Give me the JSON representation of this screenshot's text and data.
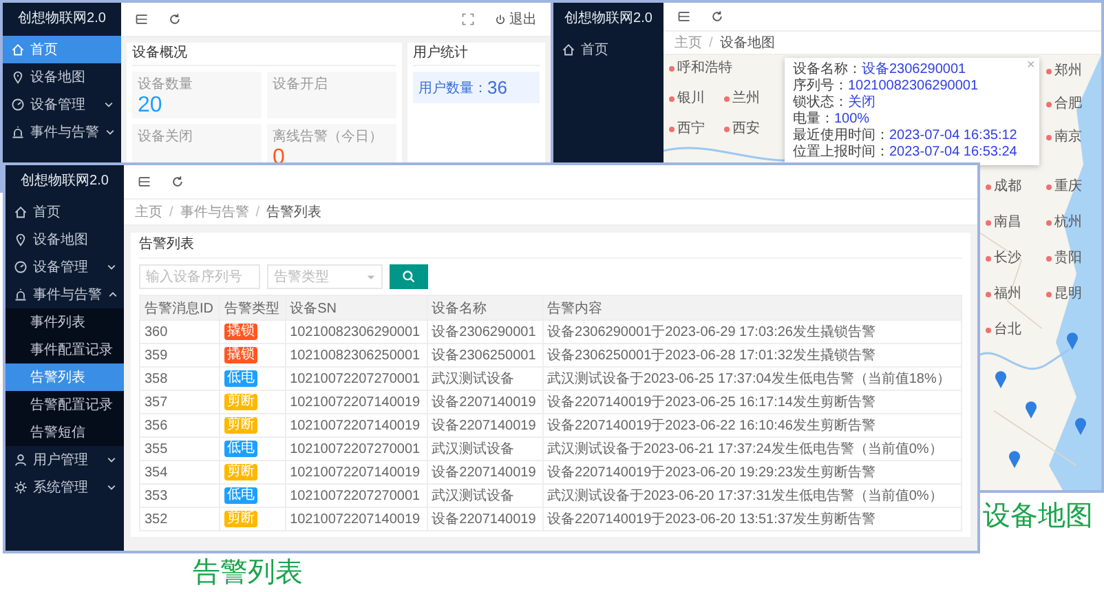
{
  "dashboard_window": {
    "app_title": "创想物联网2.0",
    "menu": [
      {
        "label": "首页",
        "kind": "home",
        "selected": true
      },
      {
        "label": "设备地图",
        "kind": "pin",
        "selected": false
      },
      {
        "label": "设备管理",
        "kind": "gauge",
        "selected": false,
        "expanded": false
      },
      {
        "label": "事件与告警",
        "kind": "alarm",
        "selected": false,
        "expanded": false
      }
    ],
    "logout": "退出",
    "overview": {
      "title": "设备概况",
      "stats": [
        {
          "label": "设备数量",
          "value": "20",
          "color": "#1e9fff"
        },
        {
          "label": "设备开启"
        },
        {
          "label": "设备关闭"
        },
        {
          "label": "离线告警（今日）",
          "value": "0",
          "color": "#ff5722"
        }
      ]
    },
    "users": {
      "title": "用户统计",
      "label": "用户数量：",
      "value": "36"
    }
  },
  "map_window": {
    "app_title": "创想物联网2.0",
    "menu": [
      {
        "label": "首页",
        "kind": "home",
        "selected": false
      }
    ],
    "breadcrumb": {
      "separator": "/",
      "items": [
        "主页",
        "设备地图"
      ]
    },
    "popup": {
      "close": "×",
      "fields": [
        {
          "label": "设备名称：",
          "value": "设备2306290001"
        },
        {
          "label": "序列号：",
          "value": "10210082306290001"
        },
        {
          "label": "锁状态：",
          "value": "关闭"
        },
        {
          "label": "电量：",
          "value": "100%"
        },
        {
          "label": "最近使用时间：",
          "value": "2023-07-04 16:35:12"
        },
        {
          "label": "位置上报时间：",
          "value": "2023-07-04 16:53:24"
        }
      ]
    },
    "cities": [
      "呼和浩特",
      "银川",
      "西宁",
      "兰州",
      "西安",
      "郑州",
      "合肥",
      "南京",
      "成都",
      "重庆",
      "南昌",
      "杭州",
      "长沙",
      "贵阳",
      "福州",
      "昆明",
      "台北"
    ]
  },
  "alarm_window": {
    "app_title": "创想物联网2.0",
    "menu": [
      {
        "label": "首页",
        "kind": "home",
        "selected": false
      },
      {
        "label": "设备地图",
        "kind": "pin",
        "selected": false
      },
      {
        "label": "设备管理",
        "kind": "gauge",
        "selected": false,
        "expanded": false
      },
      {
        "label": "事件与告警",
        "kind": "alarm",
        "selected": false,
        "expanded": true,
        "children": [
          {
            "label": "事件列表",
            "selected": false
          },
          {
            "label": "事件配置记录",
            "selected": false
          },
          {
            "label": "告警列表",
            "selected": true
          },
          {
            "label": "告警配置记录",
            "selected": false
          },
          {
            "label": "告警短信",
            "selected": false
          }
        ]
      },
      {
        "label": "用户管理",
        "kind": "user",
        "selected": false,
        "expanded": false
      },
      {
        "label": "系统管理",
        "kind": "gear",
        "selected": false,
        "expanded": false
      }
    ],
    "breadcrumb": {
      "separator": "/",
      "items": [
        "主页",
        "事件与告警",
        "告警列表"
      ]
    },
    "card_title": "告警列表",
    "filters": {
      "serial_placeholder": "输入设备序列号",
      "type_placeholder": "告警类型"
    },
    "columns": [
      "告警消息ID",
      "告警类型",
      "设备SN",
      "设备名称",
      "告警内容"
    ],
    "rows": [
      {
        "id": "360",
        "type": "撬锁",
        "color": "#ff5722",
        "sn": "10210082306290001",
        "name": "设备2306290001",
        "content": "设备2306290001于2023-06-29 17:03:26发生撬锁告警"
      },
      {
        "id": "359",
        "type": "撬锁",
        "color": "#ff5722",
        "sn": "10210082306250001",
        "name": "设备2306250001",
        "content": "设备2306250001于2023-06-28 17:01:32发生撬锁告警"
      },
      {
        "id": "358",
        "type": "低电",
        "color": "#1e9fff",
        "sn": "10210072207270001",
        "name": "武汉测试设备",
        "content": "武汉测试设备于2023-06-25 17:37:04发生低电告警（当前值18%）"
      },
      {
        "id": "357",
        "type": "剪断",
        "color": "#ffb800",
        "sn": "10210072207140019",
        "name": "设备2207140019",
        "content": "设备2207140019于2023-06-25 16:17:14发生剪断告警"
      },
      {
        "id": "356",
        "type": "剪断",
        "color": "#ffb800",
        "sn": "10210072207140019",
        "name": "设备2207140019",
        "content": "设备2207140019于2023-06-22 16:10:46发生剪断告警"
      },
      {
        "id": "355",
        "type": "低电",
        "color": "#1e9fff",
        "sn": "10210072207270001",
        "name": "武汉测试设备",
        "content": "武汉测试设备于2023-06-21 17:37:24发生低电告警（当前值0%）"
      },
      {
        "id": "354",
        "type": "剪断",
        "color": "#ffb800",
        "sn": "10210072207140019",
        "name": "设备2207140019",
        "content": "设备2207140019于2023-06-20 19:29:23发生剪断告警"
      },
      {
        "id": "353",
        "type": "低电",
        "color": "#1e9fff",
        "sn": "10210072207270001",
        "name": "武汉测试设备",
        "content": "武汉测试设备于2023-06-20 17:37:31发生低电告警（当前值0%）"
      },
      {
        "id": "352",
        "type": "剪断",
        "color": "#ffb800",
        "sn": "10210072207140019",
        "name": "设备2207140019",
        "content": "设备2207140019于2023-06-20 13:51:37发生剪断告警"
      }
    ]
  },
  "captions": {
    "alarm": "告警列表",
    "map": "设备地图"
  }
}
